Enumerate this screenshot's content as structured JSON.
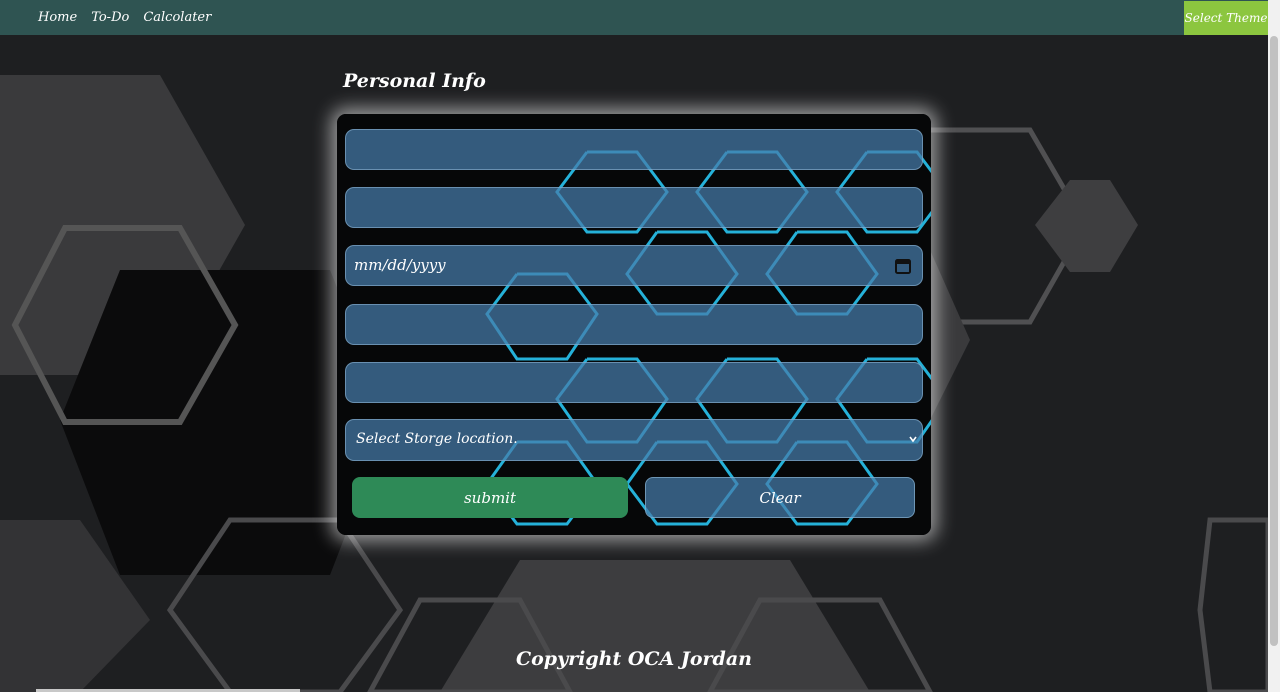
{
  "nav": {
    "links": [
      "Home",
      "To-Do",
      "Calcolater"
    ],
    "theme_button": "Select Theme"
  },
  "form": {
    "title": "Personal Info",
    "date_placeholder": "mm/dd/yyyy",
    "select_value": "Select Storge location.",
    "submit_label": "submit",
    "clear_label": "Clear"
  },
  "footer": {
    "text": "Copyright OCA Jordan"
  },
  "icons": {
    "calendar": "calendar-icon",
    "dropdown": "chevron-down-icon"
  },
  "colors": {
    "navbar": "#2f5452",
    "theme_button": "#8cc63f",
    "submit": "#2e8a57",
    "field": "#467daa",
    "neon": "#29c4f0"
  }
}
